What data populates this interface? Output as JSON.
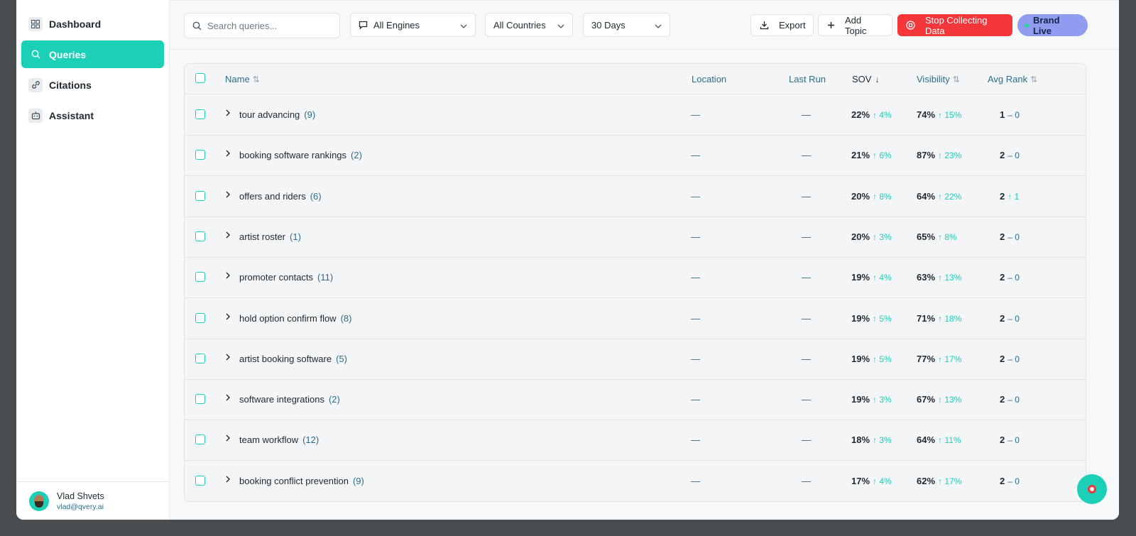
{
  "sidebar": {
    "items": [
      {
        "label": "Dashboard",
        "icon": "dashboard-icon",
        "active": false
      },
      {
        "label": "Queries",
        "icon": "search-icon",
        "active": true
      },
      {
        "label": "Citations",
        "icon": "link-icon",
        "active": false
      },
      {
        "label": "Assistant",
        "icon": "bot-icon",
        "active": false
      }
    ],
    "user": {
      "name": "Vlad Shvets",
      "email": "vlad@qvery.ai"
    }
  },
  "toolbar": {
    "search_placeholder": "Search queries...",
    "engines": "All Engines",
    "countries": "All Countries",
    "period": "30 Days",
    "export": "Export",
    "add_topic": "Add Topic",
    "stop": "Stop Collecting Data",
    "brand_live": "Brand Live"
  },
  "table": {
    "headers": {
      "name": "Name",
      "location": "Location",
      "last_run": "Last Run",
      "sov": "SOV",
      "visibility": "Visibility",
      "avg_rank": "Avg Rank"
    },
    "rows": [
      {
        "name": "tour advancing",
        "count": "(9)",
        "location": "—",
        "last_run": "—",
        "sov": "22%",
        "sov_delta": "↑ 4%",
        "vis": "74%",
        "vis_delta": "↑ 15%",
        "rank": "1",
        "rank_delta": "– 0"
      },
      {
        "name": "booking software rankings",
        "count": "(2)",
        "location": "—",
        "last_run": "—",
        "sov": "21%",
        "sov_delta": "↑ 6%",
        "vis": "87%",
        "vis_delta": "↑ 23%",
        "rank": "2",
        "rank_delta": "– 0"
      },
      {
        "name": "offers and riders",
        "count": "(6)",
        "location": "—",
        "last_run": "—",
        "sov": "20%",
        "sov_delta": "↑ 8%",
        "vis": "64%",
        "vis_delta": "↑ 22%",
        "rank": "2",
        "rank_delta": "↑ 1"
      },
      {
        "name": "artist roster",
        "count": "(1)",
        "location": "—",
        "last_run": "—",
        "sov": "20%",
        "sov_delta": "↑ 3%",
        "vis": "65%",
        "vis_delta": "↑ 8%",
        "rank": "2",
        "rank_delta": "– 0"
      },
      {
        "name": "promoter contacts",
        "count": "(11)",
        "location": "—",
        "last_run": "—",
        "sov": "19%",
        "sov_delta": "↑ 4%",
        "vis": "63%",
        "vis_delta": "↑ 13%",
        "rank": "2",
        "rank_delta": "– 0"
      },
      {
        "name": "hold option confirm flow",
        "count": "(8)",
        "location": "—",
        "last_run": "—",
        "sov": "19%",
        "sov_delta": "↑ 5%",
        "vis": "71%",
        "vis_delta": "↑ 18%",
        "rank": "2",
        "rank_delta": "– 0"
      },
      {
        "name": "artist booking software",
        "count": "(5)",
        "location": "—",
        "last_run": "—",
        "sov": "19%",
        "sov_delta": "↑ 5%",
        "vis": "77%",
        "vis_delta": "↑ 17%",
        "rank": "2",
        "rank_delta": "– 0"
      },
      {
        "name": "software integrations",
        "count": "(2)",
        "location": "—",
        "last_run": "—",
        "sov": "19%",
        "sov_delta": "↑ 3%",
        "vis": "67%",
        "vis_delta": "↑ 13%",
        "rank": "2",
        "rank_delta": "– 0"
      },
      {
        "name": "team workflow",
        "count": "(12)",
        "location": "—",
        "last_run": "—",
        "sov": "18%",
        "sov_delta": "↑ 3%",
        "vis": "64%",
        "vis_delta": "↑ 11%",
        "rank": "2",
        "rank_delta": "– 0"
      },
      {
        "name": "booking conflict prevention",
        "count": "(9)",
        "location": "—",
        "last_run": "—",
        "sov": "17%",
        "sov_delta": "↑ 4%",
        "vis": "62%",
        "vis_delta": "↑ 17%",
        "rank": "2",
        "rank_delta": "– 0"
      }
    ]
  },
  "colors": {
    "accent": "#1ccfb7",
    "danger": "#f2363a",
    "brand": "#8f9cf0"
  }
}
